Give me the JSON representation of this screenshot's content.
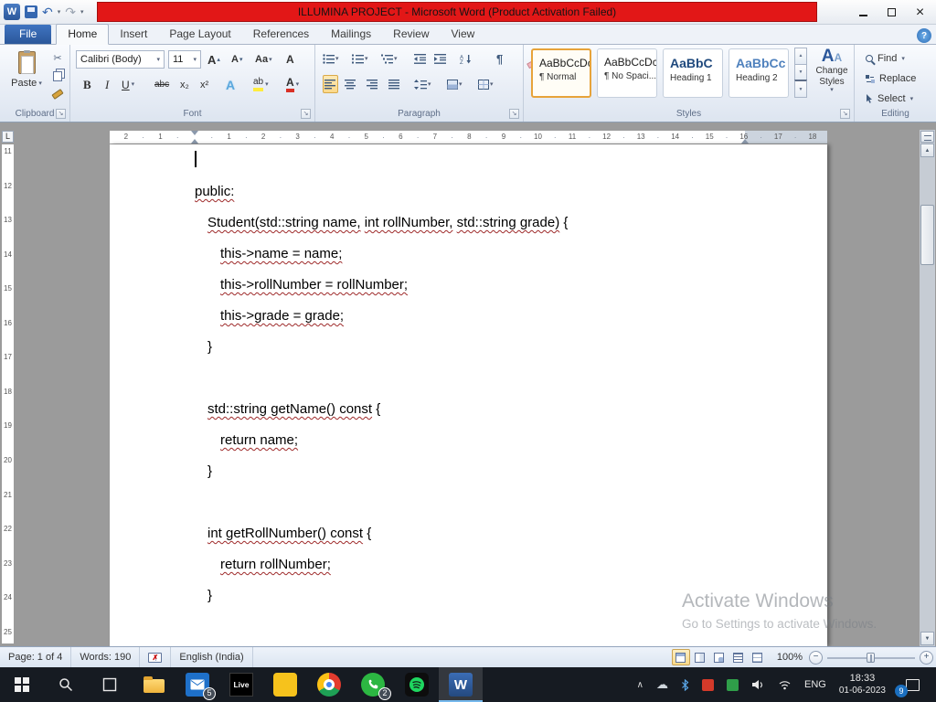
{
  "ui": {
    "caret": "▾",
    "close": "×",
    "help": "?",
    "undo": "↶",
    "redo": "↷",
    "cut": "✂",
    "launcher": "↘",
    "scroll_up": "▲",
    "scroll_down": "▼",
    "app_letter": "W",
    "spell_mark": "✗"
  },
  "titlebar": {
    "title": "ILLUMINA PROJECT -  Microsoft Word (Product Activation Failed)"
  },
  "tabs": {
    "file": "File",
    "home": "Home",
    "insert": "Insert",
    "page_layout": "Page Layout",
    "references": "References",
    "mailings": "Mailings",
    "review": "Review",
    "view": "View"
  },
  "clipboard": {
    "label": "Clipboard",
    "paste": "Paste"
  },
  "font": {
    "label": "Font",
    "family": "Calibri (Body)",
    "size": "11",
    "grow": "A",
    "shrink": "A",
    "change_case": "Aa",
    "clear": "A",
    "bold": "B",
    "italic": "I",
    "underline": "U",
    "strike": "abc",
    "subscript": "x₂",
    "superscript": "x²",
    "effects": "A",
    "highlight": "ab",
    "color": "A"
  },
  "paragraph": {
    "label": "Paragraph",
    "pilcrow": "¶"
  },
  "styles": {
    "label": "Styles",
    "icon_letter": "A",
    "change_styles": "Change Styles",
    "gallery": [
      {
        "sample": "AaBbCcDc",
        "name": "¶ Normal",
        "selected": true,
        "sample_color": "#1a1a1a"
      },
      {
        "sample": "AaBbCcDc",
        "name": "¶ No Spaci...",
        "sample_color": "#1a1a1a"
      },
      {
        "sample": "AaBbC",
        "name": "Heading 1",
        "sample_color": "#1f497d"
      },
      {
        "sample": "AaBbCc",
        "name": "Heading 2",
        "sample_color": "#4f81bd"
      }
    ]
  },
  "editing": {
    "label": "Editing",
    "find": "Find",
    "replace": "Replace",
    "select": "Select"
  },
  "ruler": {
    "tab_selector": "L",
    "h_left": [
      "1",
      "2"
    ],
    "h_right": [
      "1",
      "2",
      "3",
      "4",
      "5",
      "6",
      "7",
      "8",
      "9",
      "10",
      "11",
      "12",
      "13",
      "14",
      "15",
      "16",
      "17",
      "18"
    ],
    "v": [
      "11",
      "12",
      "13",
      "14",
      "15",
      "16",
      "17",
      "18",
      "19",
      "20",
      "21",
      "22",
      "23",
      "24",
      "25"
    ]
  },
  "document": {
    "lines": [
      {
        "indent": 0,
        "cursor": true,
        "segments": []
      },
      {
        "indent": 0,
        "segments": [
          {
            "t": "public:",
            "u": true
          }
        ]
      },
      {
        "indent": 1,
        "segments": [
          {
            "t": "Student(std::string name,",
            "u": true
          },
          {
            "t": " ",
            "u": false
          },
          {
            "t": "int rollNumber,",
            "u": true
          },
          {
            "t": " ",
            "u": false
          },
          {
            "t": "std::string grade)",
            "u": true
          },
          {
            "t": " {",
            "u": false
          }
        ]
      },
      {
        "indent": 2,
        "segments": [
          {
            "t": "this->name = name;",
            "u": true
          }
        ]
      },
      {
        "indent": 2,
        "segments": [
          {
            "t": "this->rollNumber = rollNumber;",
            "u": true
          }
        ]
      },
      {
        "indent": 2,
        "segments": [
          {
            "t": "this->grade = grade;",
            "u": true
          }
        ]
      },
      {
        "indent": 1,
        "segments": [
          {
            "t": "}",
            "u": false
          }
        ]
      },
      {
        "indent": 0,
        "segments": []
      },
      {
        "indent": 1,
        "segments": [
          {
            "t": "std::string getName() const",
            "u": true
          },
          {
            "t": " {",
            "u": false
          }
        ]
      },
      {
        "indent": 2,
        "segments": [
          {
            "t": "return name;",
            "u": true
          }
        ]
      },
      {
        "indent": 1,
        "segments": [
          {
            "t": "}",
            "u": false
          }
        ]
      },
      {
        "indent": 0,
        "segments": []
      },
      {
        "indent": 1,
        "segments": [
          {
            "t": "int getRollNumber() const",
            "u": true
          },
          {
            "t": " {",
            "u": false
          }
        ]
      },
      {
        "indent": 2,
        "segments": [
          {
            "t": "return rollNumber;",
            "u": true
          }
        ]
      },
      {
        "indent": 1,
        "segments": [
          {
            "t": "}",
            "u": false
          }
        ]
      }
    ]
  },
  "watermark": {
    "line1": "Activate Windows",
    "line2": "Go to Settings to activate Windows."
  },
  "statusbar": {
    "page": "Page: 1 of 4",
    "words": "Words: 190",
    "language": "English (India)",
    "zoom": "100%",
    "zoom_minus": "−",
    "zoom_plus": "+"
  },
  "taskbar": {
    "live": "Live",
    "badges": {
      "mail": "5",
      "whatsapp": "2",
      "notifications": "9"
    },
    "tray": {
      "hidden": "∧",
      "language": "ENG",
      "time": "18:33",
      "date": "01-06-2023"
    }
  }
}
